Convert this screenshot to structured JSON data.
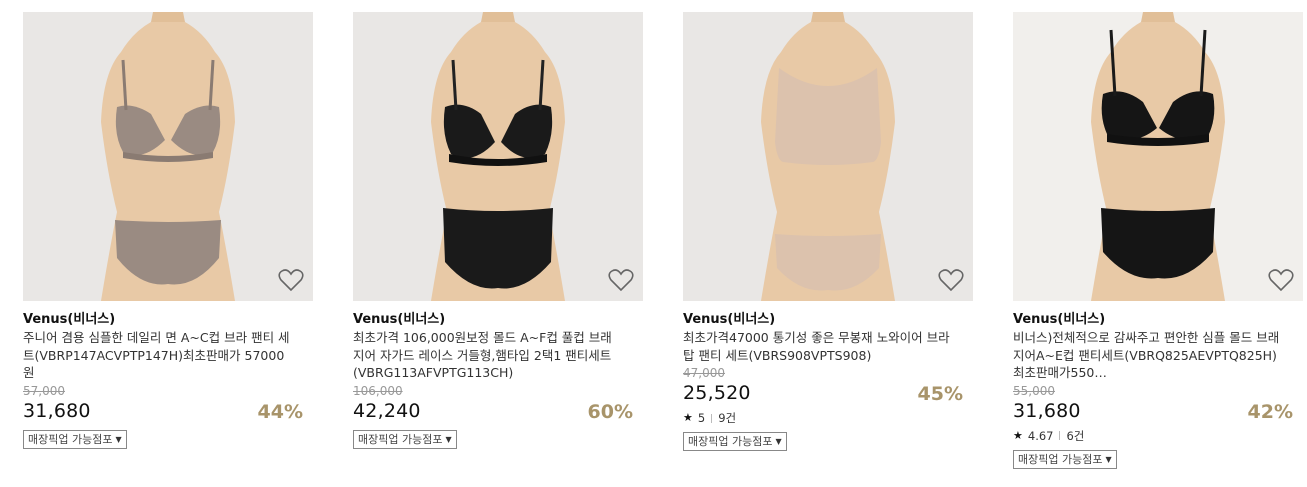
{
  "products": [
    {
      "brand": "Venus(비너스)",
      "title": "주니어 겸용 심플한 데일리 면 A~C컵 브라 팬티 세트(VBRP147ACVPTP147H)최초판매가 57000원",
      "original_price": "57,000",
      "sale_price": "31,680",
      "discount": "44%",
      "pickup_label": "매장픽업 가능점포",
      "wishlist_icon": "heart-outline-icon",
      "product_color": "#9a8b82"
    },
    {
      "brand": "Venus(비너스)",
      "title": "최초가격 106,000원보정 몰드 A~F컵 풀컵 브래지어 자가드 레이스 거들형,햄타입 2택1 팬티세트(VBRG113AFVPTG113CH)",
      "original_price": "106,000",
      "sale_price": "42,240",
      "discount": "60%",
      "pickup_label": "매장픽업 가능점포",
      "wishlist_icon": "heart-outline-icon",
      "product_color": "#1a1a1a"
    },
    {
      "brand": "Venus(비너스)",
      "title": "최초가격47000 통기성 좋은 무봉재 노와이어 브라탑 팬티 세트(VBRS908VPTS908)",
      "original_price": "47,000",
      "sale_price": "25,520",
      "discount": "45%",
      "rating": "5",
      "review_count": "9건",
      "pickup_label": "매장픽업 가능점포",
      "wishlist_icon": "heart-outline-icon",
      "product_color": "#dcc2ad"
    },
    {
      "brand": "Venus(비너스)",
      "title": "비너스)전체적으로 감싸주고 편안한 심플 몰드 브래지어A~E컵 팬티세트(VBRQ825AEVPTQ825H)최초판매가550…",
      "original_price": "55,000",
      "sale_price": "31,680",
      "discount": "42%",
      "rating": "4.67",
      "review_count": "6건",
      "pickup_label": "매장픽업 가능점포",
      "wishlist_icon": "heart-outline-icon",
      "product_color": "#151515"
    }
  ],
  "icons": {
    "star": "★",
    "caret": "▼"
  }
}
